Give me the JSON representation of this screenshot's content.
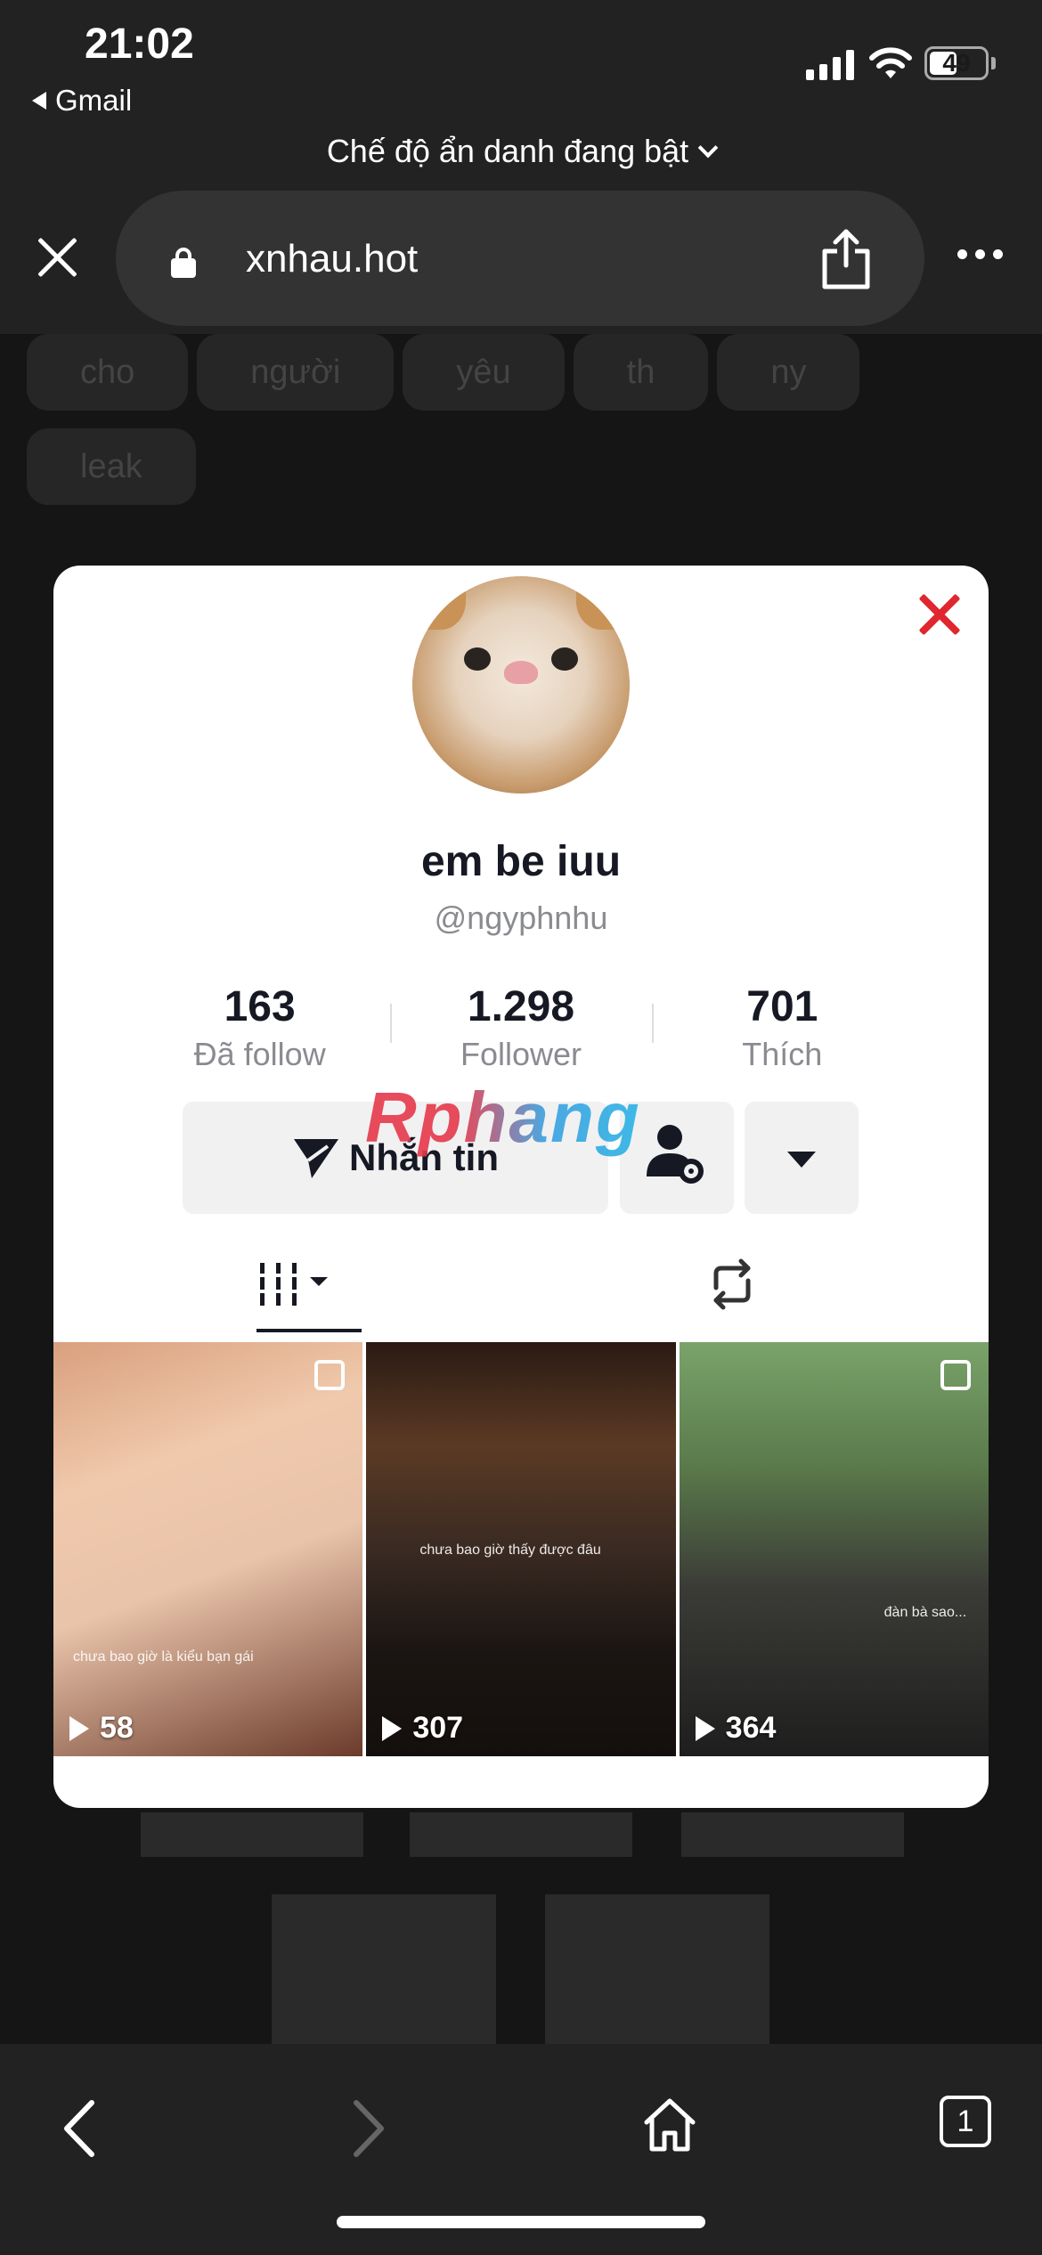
{
  "status_bar": {
    "time": "21:02",
    "back_app": "Gmail",
    "battery": "49"
  },
  "browser": {
    "private_mode": "Chế độ ẩn danh đang bật",
    "url": "xnhau.hot",
    "tabs_count": "1"
  },
  "background_page": {
    "tags": [
      "cho",
      "người",
      "yêu",
      "th",
      "ny",
      "leak"
    ]
  },
  "profile": {
    "username": "em be iuu",
    "handle": "@ngyphnhu",
    "stats": [
      {
        "value": "163",
        "label": "Đã follow"
      },
      {
        "value": "1.298",
        "label": "Follower"
      },
      {
        "value": "701",
        "label": "Thích"
      }
    ],
    "message_button": "Nhắn tin",
    "watermark": "Rphang"
  },
  "videos": [
    {
      "views": "58",
      "caption": "chưa bao giờ là kiểu bạn gái"
    },
    {
      "views": "307",
      "caption": "chưa bao giờ thấy được đâu"
    },
    {
      "views": "364",
      "caption": "đàn bà sao..."
    }
  ],
  "colors": {
    "accent_red": "#e0262e",
    "modal_bg": "#ffffff",
    "chrome_bg": "#222222"
  }
}
